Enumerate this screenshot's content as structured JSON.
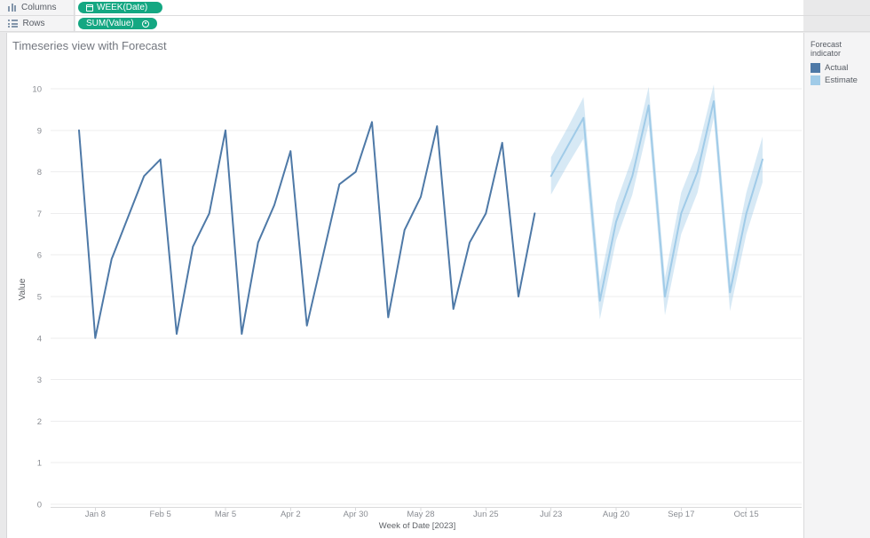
{
  "shelves": {
    "columns": {
      "label": "Columns",
      "pill": "WEEK(Date)"
    },
    "rows": {
      "label": "Rows",
      "pill": "SUM(Value)"
    }
  },
  "legend": {
    "title": "Forecast indicator",
    "items": [
      {
        "label": "Actual",
        "color": "#4e79a7"
      },
      {
        "label": "Estimate",
        "color": "#a0cbe8"
      }
    ]
  },
  "chart_data": {
    "type": "line",
    "title": "Timeseries view with Forecast",
    "xlabel": "Week of Date [2023]",
    "ylabel": "Value",
    "ylim": [
      0,
      10
    ],
    "y_ticks": [
      0,
      1,
      2,
      3,
      4,
      5,
      6,
      7,
      8,
      9,
      10
    ],
    "grid": "horizontal",
    "legend_position": "right",
    "x_tick_labels": [
      "Jan 8",
      "Feb 5",
      "Mar 5",
      "Apr 2",
      "Apr 30",
      "May 28",
      "Jun 25",
      "Jul 23",
      "Aug 20",
      "Sep 17",
      "Oct 15"
    ],
    "x_tick_week_indices": [
      1,
      5,
      9,
      13,
      17,
      21,
      25,
      29,
      33,
      37,
      41
    ],
    "series": [
      {
        "name": "Actual",
        "color": "#4e79a7",
        "start_week_index": 0,
        "dates": [
          "Jan 1",
          "Jan 8",
          "Jan 15",
          "Jan 22",
          "Jan 29",
          "Feb 5",
          "Feb 12",
          "Feb 19",
          "Feb 26",
          "Mar 5",
          "Mar 12",
          "Mar 19",
          "Mar 26",
          "Apr 2",
          "Apr 9",
          "Apr 16",
          "Apr 23",
          "Apr 30",
          "May 7",
          "May 14",
          "May 21",
          "May 28",
          "Jun 4",
          "Jun 11",
          "Jun 18",
          "Jun 25",
          "Jul 2",
          "Jul 9",
          "Jul 16"
        ],
        "values": [
          9.0,
          4.0,
          5.9,
          6.9,
          7.9,
          8.3,
          4.1,
          6.2,
          7.0,
          9.0,
          4.1,
          6.3,
          7.2,
          8.5,
          4.3,
          6.0,
          7.7,
          8.0,
          9.2,
          4.5,
          6.6,
          7.4,
          9.1,
          4.7,
          6.3,
          7.0,
          8.7,
          5.0,
          7.0
        ]
      },
      {
        "name": "Estimate",
        "color": "#a0cbe8",
        "start_week_index": 29,
        "dates": [
          "Jul 23",
          "Jul 30",
          "Aug 6",
          "Aug 13",
          "Aug 20",
          "Aug 27",
          "Sep 3",
          "Sep 10",
          "Sep 17",
          "Sep 24",
          "Oct 1",
          "Oct 8",
          "Oct 15",
          "Oct 22"
        ],
        "values": [
          7.9,
          8.6,
          9.3,
          4.9,
          6.8,
          7.9,
          9.6,
          5.0,
          7.0,
          8.0,
          9.7,
          5.1,
          7.0,
          8.3
        ],
        "band_half_width": [
          0.45,
          0.45,
          0.5,
          0.45,
          0.45,
          0.45,
          0.45,
          0.45,
          0.5,
          0.5,
          0.4,
          0.45,
          0.5,
          0.55
        ],
        "band_fill": "#a0cbe8",
        "band_opacity": 0.42
      }
    ]
  }
}
